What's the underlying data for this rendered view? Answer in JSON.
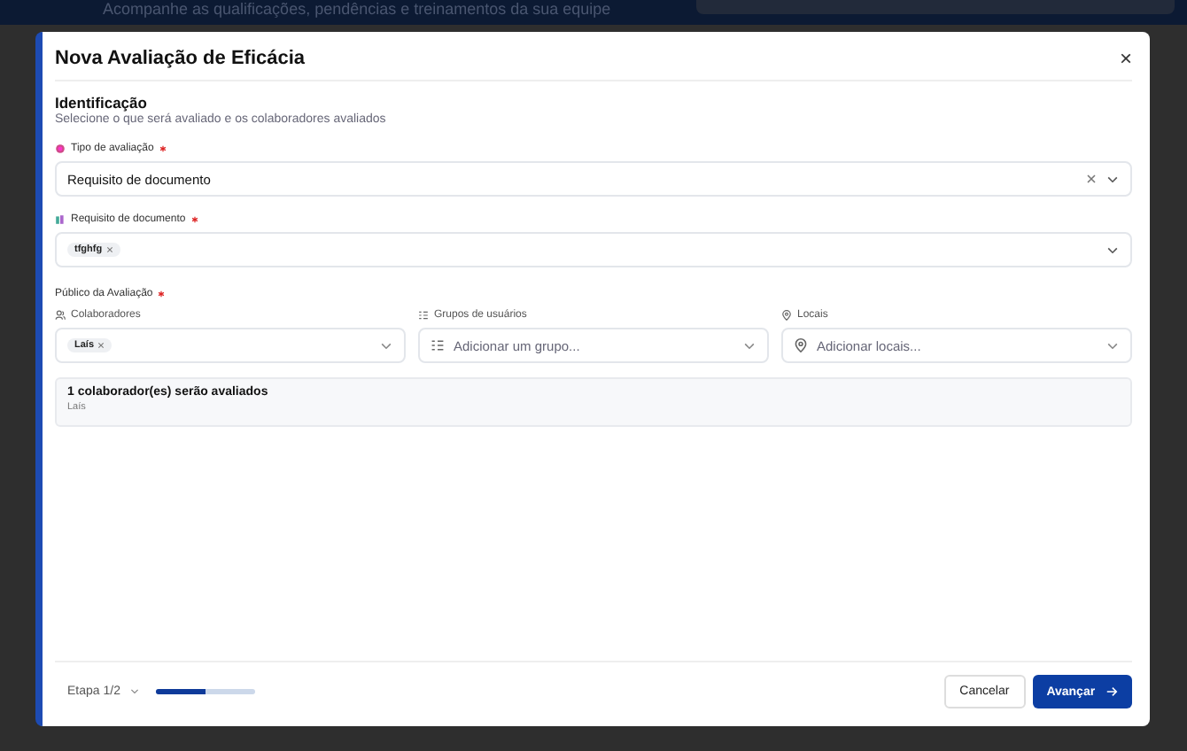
{
  "background": {
    "subtitle": "Acompanhe as qualificações, pendências e treinamentos da sua equipe"
  },
  "modal": {
    "title": "Nova Avaliação de Eficácia",
    "close": "×"
  },
  "section": {
    "title": "Identificação",
    "description": "Selecione o que será avaliado e os colaboradores avaliados"
  },
  "tipo": {
    "label": "Tipo de avaliação",
    "required": true,
    "value": "Requisito de documento"
  },
  "requisito": {
    "label": "Requisito de documento",
    "required": true,
    "tags": [
      "tfghfg"
    ]
  },
  "publico": {
    "label": "Público da Avaliação",
    "required": true,
    "fields": [
      {
        "kind": "people",
        "label": "Colaboradores",
        "tags": [
          "Laís"
        ]
      },
      {
        "kind": "groups",
        "label": "Grupos de usuários",
        "placeholder": "Adicionar um grupo..."
      },
      {
        "kind": "places",
        "label": "Locais",
        "placeholder": "Adicionar locais..."
      }
    ]
  },
  "summary": {
    "title": "1 colaborador(es) serão avaliados",
    "names": "Laís"
  },
  "footer": {
    "step": "Etapa 1/2",
    "level": 0.5,
    "cancel": "Cancelar",
    "next": "Avançar"
  }
}
